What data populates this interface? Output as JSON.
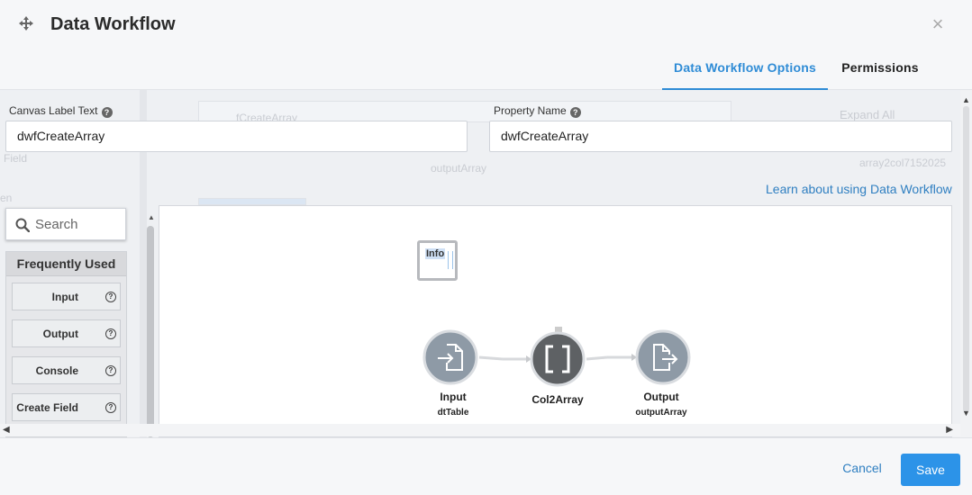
{
  "header": {
    "title": "Data Workflow",
    "tabs": [
      {
        "label": "Data Workflow Options",
        "active": true
      },
      {
        "label": "Permissions",
        "active": false
      }
    ]
  },
  "fields": {
    "canvas_label": {
      "label": "Canvas Label Text",
      "value": "dwfCreateArray"
    },
    "property_name": {
      "label": "Property Name",
      "value": "dwfCreateArray"
    }
  },
  "learn_link": "Learn about using Data Workflow",
  "palette": {
    "search_placeholder": "Search",
    "section_title": "Frequently Used",
    "items": [
      {
        "label": "Input"
      },
      {
        "label": "Output"
      },
      {
        "label": "Console"
      },
      {
        "label": "Create Field"
      }
    ]
  },
  "canvas": {
    "info_node": {
      "label": "Info"
    },
    "nodes": [
      {
        "title": "Input",
        "subtitle": "dtTable",
        "icon": "file-import-icon"
      },
      {
        "title": "Col2Array",
        "subtitle": "",
        "icon": "brackets-icon"
      },
      {
        "title": "Output",
        "subtitle": "outputArray",
        "icon": "file-export-icon"
      }
    ]
  },
  "background_ghost": {
    "field_text": "Field",
    "en_text": "en",
    "expand_all": "Expand All",
    "array_label": "array2col7152025",
    "output_array": "outputArray",
    "create_array": "fCreateArray"
  },
  "footer": {
    "cancel_label": "Cancel",
    "save_label": "Save"
  },
  "colors": {
    "accent": "#2f8cd6",
    "save_button": "#2c93e8",
    "node_grey": "#8e9aa6",
    "node_dark": "#5e6164"
  }
}
